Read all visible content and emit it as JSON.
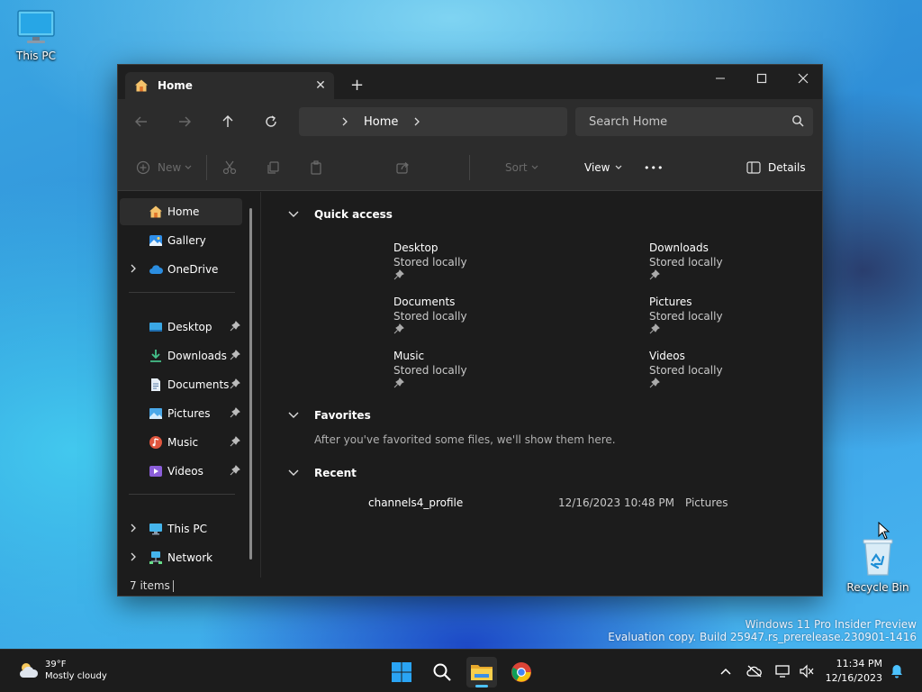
{
  "desktop": {
    "icons": [
      {
        "label": "This PC"
      },
      {
        "label": "Recycle Bin"
      }
    ],
    "watermark": {
      "line1": "Windows 11 Pro Insider Preview",
      "line2": "Evaluation copy. Build 25947.rs_prerelease.230901-1416"
    }
  },
  "window": {
    "tab": {
      "title": "Home"
    },
    "address": {
      "breadcrumb": "Home"
    },
    "search": {
      "placeholder": "Search Home"
    },
    "commandbar": {
      "new_label": "New",
      "sort_label": "Sort",
      "view_label": "View",
      "more_label": "•••",
      "details_label": "Details"
    },
    "sidebar": {
      "top": [
        {
          "label": "Home"
        },
        {
          "label": "Gallery"
        },
        {
          "label": "OneDrive"
        }
      ],
      "pinned": [
        {
          "label": "Desktop"
        },
        {
          "label": "Downloads"
        },
        {
          "label": "Documents"
        },
        {
          "label": "Pictures"
        },
        {
          "label": "Music"
        },
        {
          "label": "Videos"
        }
      ],
      "bottom": [
        {
          "label": "This PC"
        },
        {
          "label": "Network"
        }
      ]
    },
    "content": {
      "quick_access": {
        "title": "Quick access",
        "items": [
          {
            "name": "Desktop",
            "sub": "Stored locally"
          },
          {
            "name": "Downloads",
            "sub": "Stored locally"
          },
          {
            "name": "Documents",
            "sub": "Stored locally"
          },
          {
            "name": "Pictures",
            "sub": "Stored locally"
          },
          {
            "name": "Music",
            "sub": "Stored locally"
          },
          {
            "name": "Videos",
            "sub": "Stored locally"
          }
        ]
      },
      "favorites": {
        "title": "Favorites",
        "message": "After you've favorited some files, we'll show them here."
      },
      "recent": {
        "title": "Recent",
        "items": [
          {
            "name": "channels4_profile",
            "date": "12/16/2023 10:48 PM",
            "location": "Pictures"
          }
        ]
      }
    },
    "status": {
      "items": "7 items"
    }
  },
  "taskbar": {
    "weather": {
      "temp": "39°F",
      "condition": "Mostly cloudy"
    },
    "clock": {
      "time": "11:34 PM",
      "date": "12/16/2023"
    }
  },
  "colors": {
    "accent": "#0078d4",
    "window_bg": "#1c1c1c",
    "toolbar_bg": "#2c2c2c",
    "folder_yellow": "#f0c441"
  }
}
